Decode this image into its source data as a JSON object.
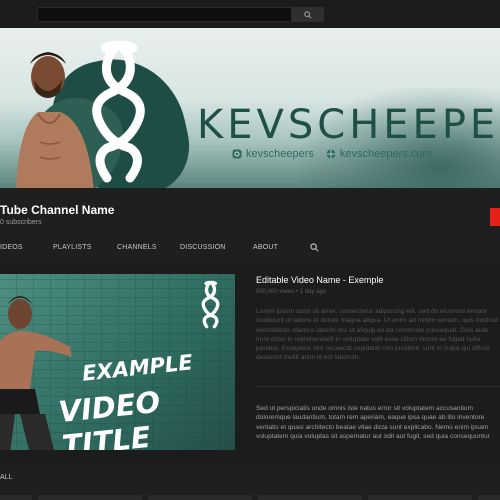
{
  "search": {
    "placeholder": ""
  },
  "banner": {
    "brand": "KEVSCHEEPERS",
    "handle_1": "kevscheepers",
    "handle_2": "kevscheepers.com"
  },
  "channel": {
    "name": "Tube Channel Name",
    "subscribers": "0 subscribers"
  },
  "tabs": [
    "IDEOS",
    "PLAYLISTS",
    "CHANNELS",
    "DISCUSSION",
    "ABOUT"
  ],
  "video": {
    "name": "Editable Video Name - Exemple",
    "meta": "000,000 views • 1 day ago",
    "thumb_line1": "EXAMPLE",
    "thumb_line2": "VIDEO TITLE",
    "desc1": "Lorem ipsum dolor sit amet, consectetur adipiscing elit, sed do eiusmod tempor incididunt ut labore et dolore magna aliqua. Ut enim ad minim veniam, quis nostrud exercitation ullamco laboris nisi ut aliquip ex ea commodo consequat. Duis aute irure dolor in reprehenderit in voluptate velit esse cillum dolore eu fugiat nulla pariatur. Excepteur sint occaecat cupidatat non proident, sunt in culpa qui officia deserunt mollit anim id est laborum.",
    "desc2": "Sed ut perspiciatis unde omnis iste natus error sit voluptatem accusantium doloremque laudantium, totam rem aperiam, eaque ipsa quae ab illo inventore veritatis et quasi architecto beatae vitae dicta sunt explicabo. Nemo enim ipsam voluptatem quia voluptas sit aspernatur aut odit aut fugit, sed quia consequuntur"
  },
  "all_label": "ALL",
  "icons": {
    "search": "search-icon",
    "camera": "instagram-icon",
    "globe": "globe-icon"
  },
  "colors": {
    "accent_red": "#e62117",
    "brand_teal": "#1f5047"
  }
}
